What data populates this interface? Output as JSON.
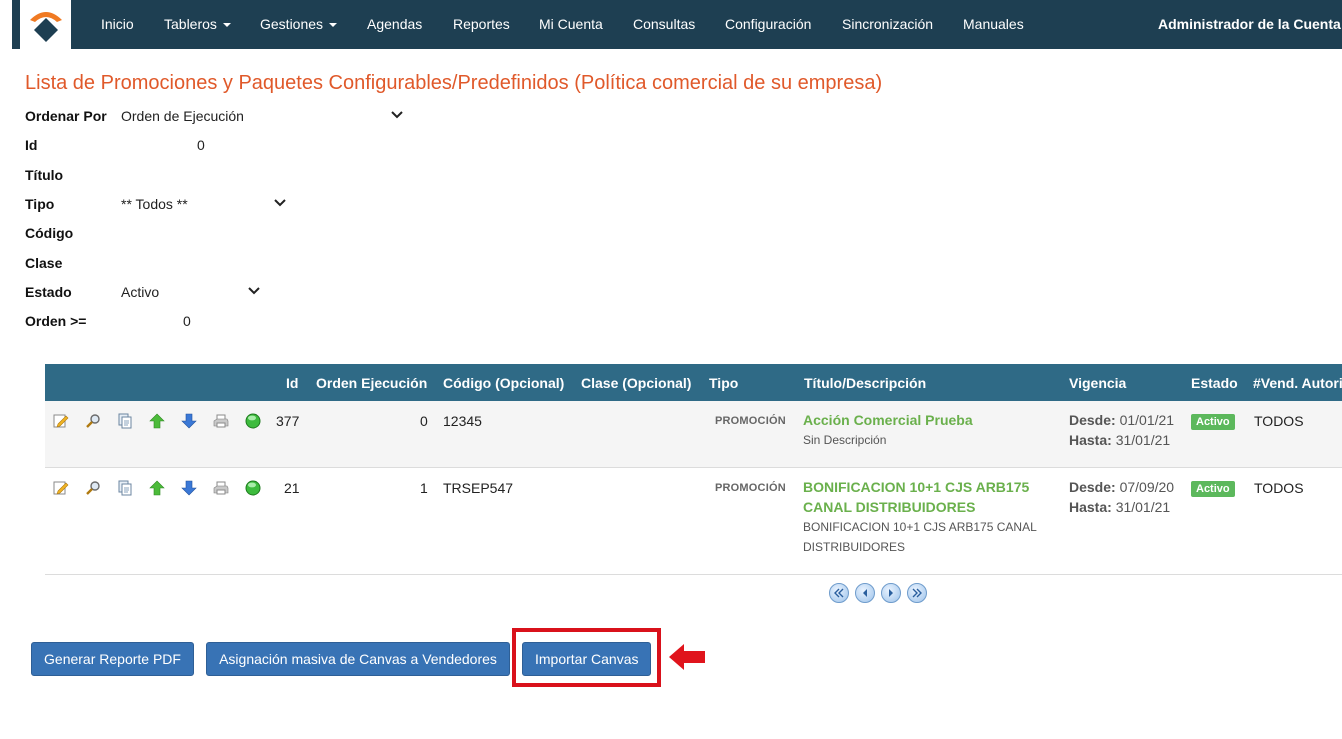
{
  "nav": {
    "items": [
      {
        "label": "Inicio"
      },
      {
        "label": "Tableros"
      },
      {
        "label": "Gestiones"
      },
      {
        "label": "Agendas"
      },
      {
        "label": "Reportes"
      },
      {
        "label": "Mi Cuenta"
      },
      {
        "label": "Consultas"
      },
      {
        "label": "Configuración"
      },
      {
        "label": "Sincronización"
      },
      {
        "label": "Manuales"
      }
    ],
    "account": "Administrador de la Cuenta"
  },
  "page": {
    "title": "Lista de Promociones y Paquetes Configurables/Predefinidos (Política comercial de su empresa)"
  },
  "filters": {
    "ordenar_por": {
      "label": "Ordenar Por",
      "value": "Orden de Ejecución"
    },
    "id": {
      "label": "Id",
      "value": "0"
    },
    "titulo": {
      "label": "Título"
    },
    "tipo": {
      "label": "Tipo",
      "value": "** Todos **"
    },
    "codigo": {
      "label": "Código"
    },
    "clase": {
      "label": "Clase"
    },
    "estado": {
      "label": "Estado",
      "value": "Activo"
    },
    "orden": {
      "label": "Orden >=",
      "value": "0"
    }
  },
  "table": {
    "headers": {
      "id": "Id",
      "orden": "Orden Ejecución",
      "codigo": "Código (Opcional)",
      "clase": "Clase (Opcional)",
      "tipo": "Tipo",
      "titulo": "Título/Descripción",
      "vigencia": "Vigencia",
      "estado": "Estado",
      "vend": "#Vend. Autori"
    },
    "rows": [
      {
        "id": "377",
        "orden": "0",
        "codigo": "12345",
        "tipo": "PROMOCIÓN",
        "titulo": "Acción Comercial Prueba",
        "descripcion": "Sin Descripción",
        "desde_label": "Desde:",
        "desde": "01/01/21",
        "hasta_label": "Hasta:",
        "hasta": "31/01/21",
        "estado": "Activo",
        "vend": "TODOS"
      },
      {
        "id": "21",
        "orden": "1",
        "codigo": "TRSEP547",
        "tipo": "PROMOCIÓN",
        "titulo": "BONIFICACION 10+1 CJS ARB175 CANAL DISTRIBUIDORES",
        "descripcion": "BONIFICACION 10+1 CJS ARB175 CANAL DISTRIBUIDORES",
        "desde_label": "Desde:",
        "desde": "07/09/20",
        "hasta_label": "Hasta:",
        "hasta": "31/01/21",
        "estado": "Activo",
        "vend": "TODOS"
      }
    ],
    "row_icons": [
      "edit-icon",
      "magnifier-icon",
      "copy-icon",
      "arrow-up-icon",
      "arrow-down-icon",
      "printer-icon",
      "status-green-icon"
    ]
  },
  "buttons": {
    "pdf": "Generar Reporte PDF",
    "asignacion": "Asignación masiva de Canvas a Vendedores",
    "importar": "Importar Canvas"
  },
  "colors": {
    "navbar": "#1e3f52",
    "title": "#e0592a",
    "table_header": "#2f6a86",
    "link_green": "#6ab04c",
    "badge": "#5cb85c",
    "button": "#3873b5",
    "highlight": "#d9111b"
  }
}
